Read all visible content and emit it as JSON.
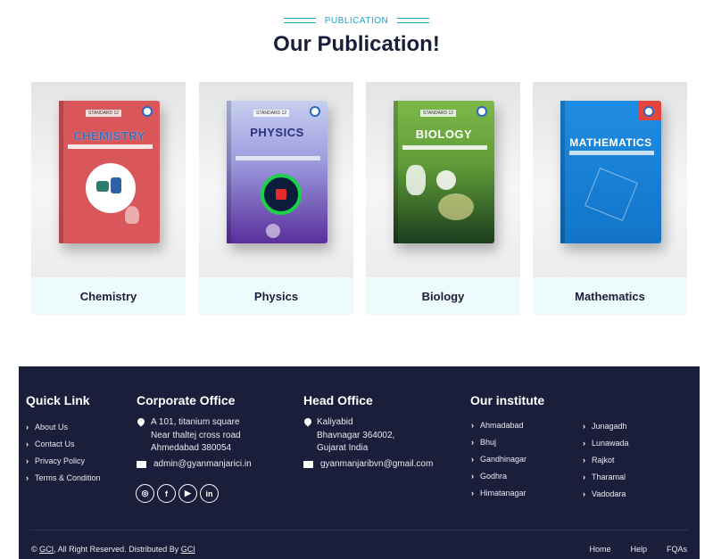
{
  "publication": {
    "kicker": "PUBLICATION",
    "title": "Our Publication!",
    "books": [
      {
        "label": "Chemistry",
        "cover_title": "CHEMISTRY",
        "cover_color": "#d9565b"
      },
      {
        "label": "Physics",
        "cover_title": "PHYSICS",
        "cover_color": "#5a2f9c"
      },
      {
        "label": "Biology",
        "cover_title": "BIOLOGY",
        "cover_color": "#5f9c38"
      },
      {
        "label": "Mathematics",
        "cover_title": "MATHEMATICS",
        "cover_color": "#1274c8"
      }
    ]
  },
  "footer": {
    "quick_link": {
      "heading": "Quick Link",
      "items": [
        "About Us",
        "Contact Us",
        "Privacy Policy",
        "Terms & Condition"
      ]
    },
    "corporate_office": {
      "heading": "Corporate Office",
      "address": [
        "A 101, titanium square",
        "Near thaltej cross road",
        "Ahmedabad 380054"
      ],
      "email": "admin@gyanmanjarici.in"
    },
    "head_office": {
      "heading": "Head Office",
      "address": [
        "Kaliyabid",
        "Bhavnagar 364002,",
        "Gujarat India"
      ],
      "email": "gyanmanjaribvn@gmail.com"
    },
    "institute": {
      "heading": "Our institute",
      "col1": [
        "Ahmadabad",
        "Bhuj",
        "Gandhinagar",
        "Godhra",
        "Himatanagar"
      ],
      "col2": [
        "Junagadh",
        "Lunawada",
        "Rajkot",
        "Tharamal",
        "Vadodara"
      ]
    },
    "socials": [
      "instagram-icon",
      "facebook-icon",
      "youtube-icon",
      "linkedin-icon"
    ],
    "copyright": {
      "prefix": "© ",
      "brand": "GCI",
      "middle": ", All Right Reserved. Distributed By ",
      "distributor": "GCI"
    },
    "bottom_links": [
      "Home",
      "Help",
      "FQAs"
    ],
    "bg_color": "#1b1e3a"
  }
}
